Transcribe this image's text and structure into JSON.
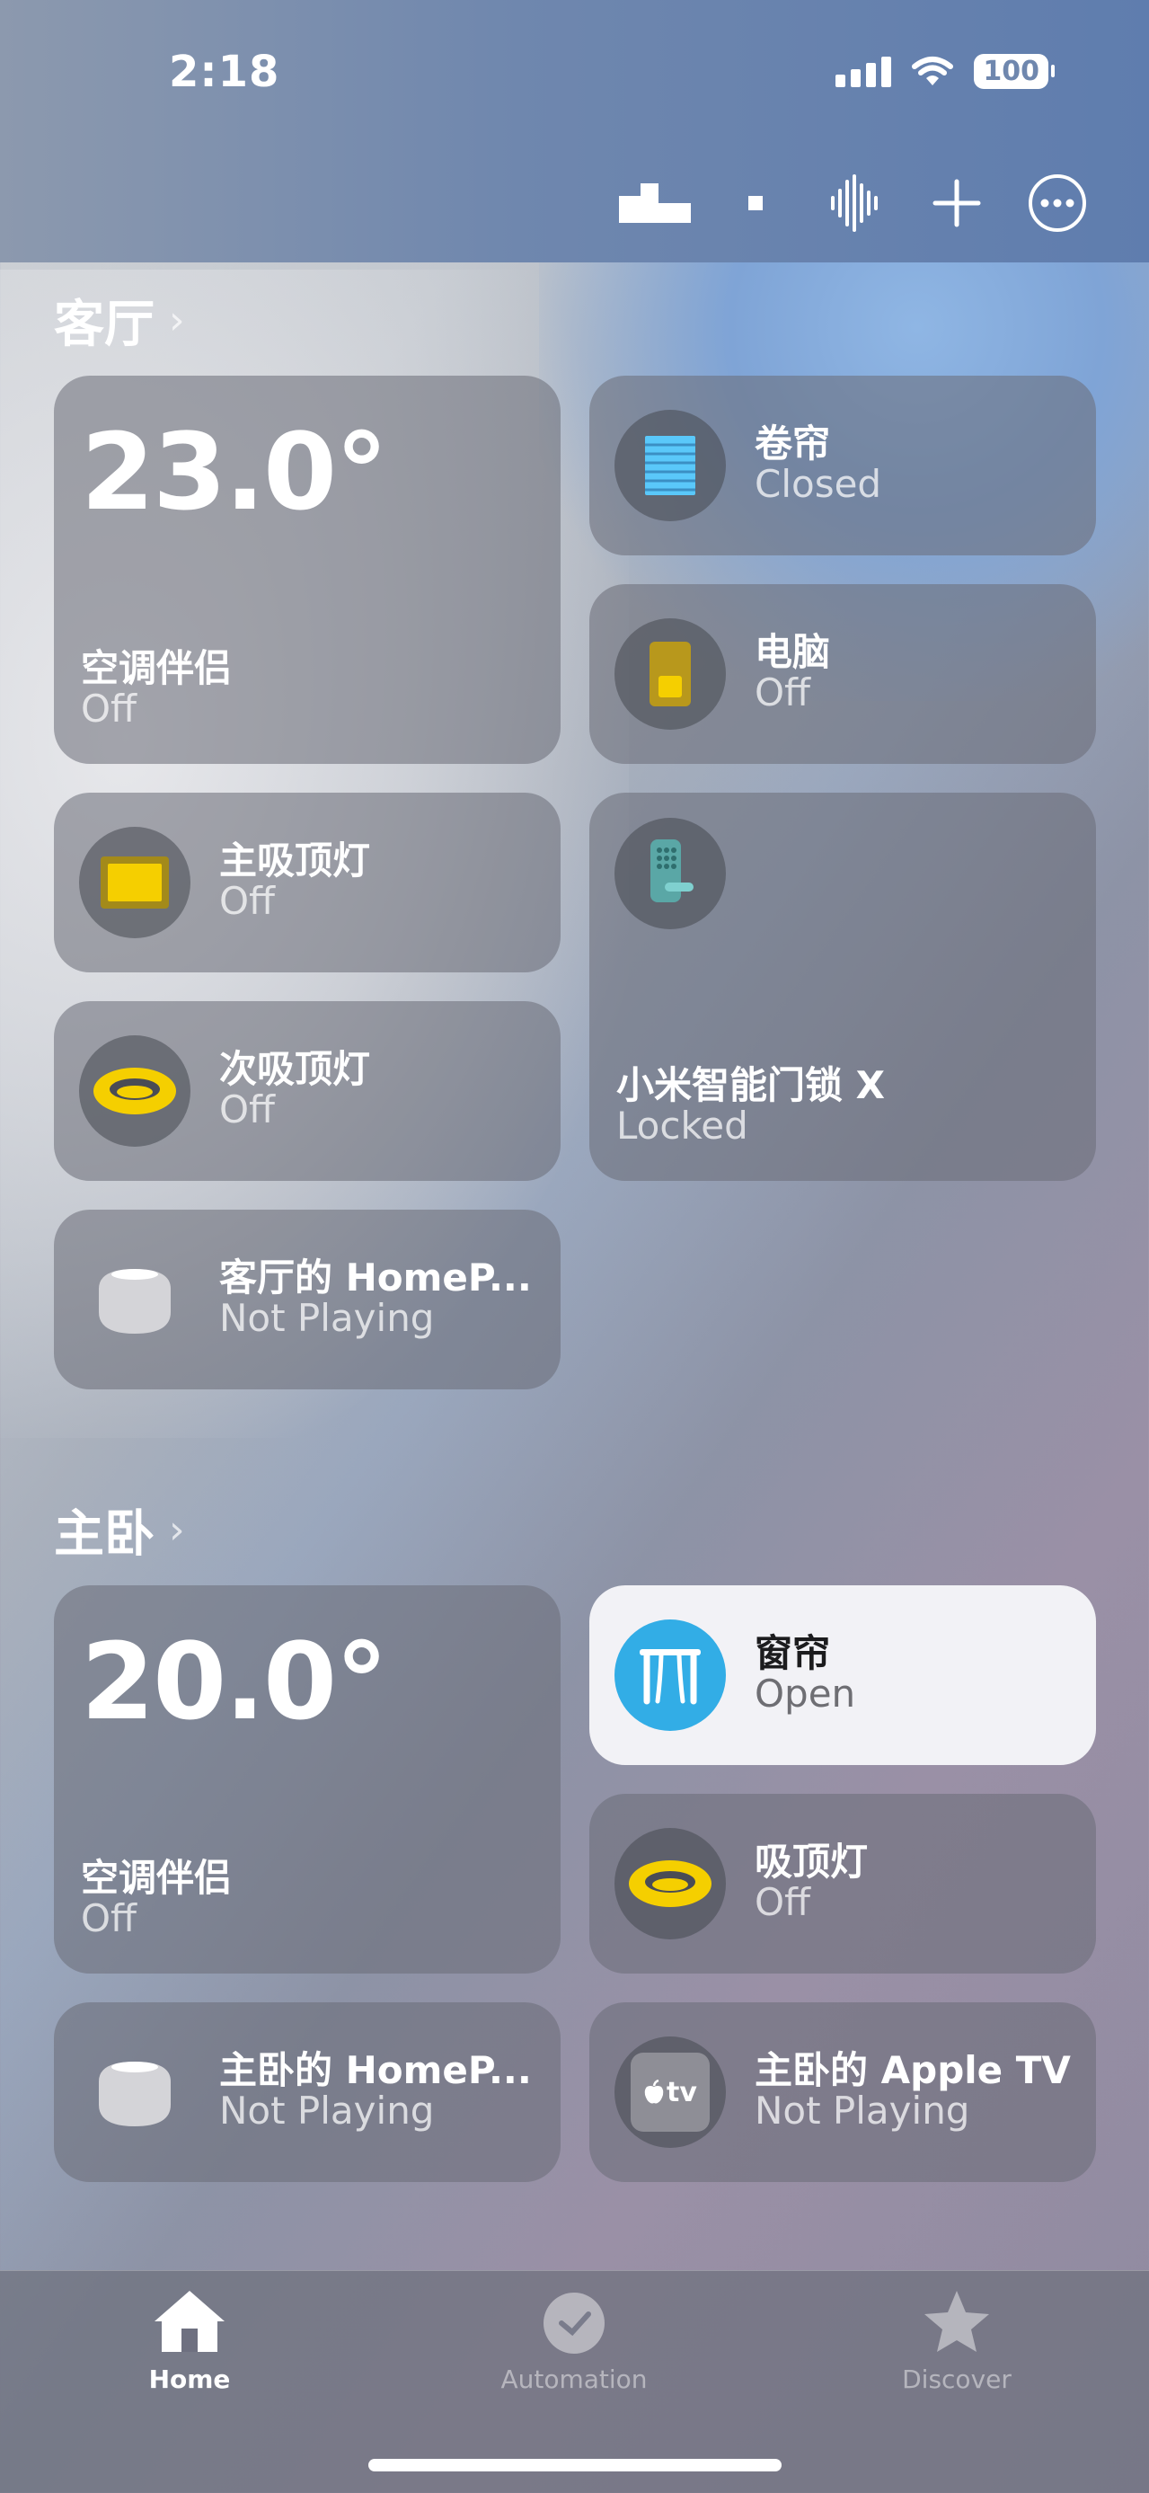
{
  "status_bar": {
    "time": "2:18",
    "battery": "100"
  },
  "rooms": [
    {
      "name": "客厅",
      "tiles": [
        {
          "name": "空调伴侣",
          "state": "Off",
          "temperature": "23.0°"
        },
        {
          "name": "卷帘",
          "state": "Closed",
          "icon": "blinds-icon"
        },
        {
          "name": "电脑",
          "state": "Off",
          "icon": "outlet-icon"
        },
        {
          "name": "主吸顶灯",
          "state": "Off",
          "icon": "panel-light-icon"
        },
        {
          "name": "小米智能门锁 X",
          "state": "Locked",
          "icon": "door-lock-icon"
        },
        {
          "name": "次吸顶灯",
          "state": "Off",
          "icon": "ceiling-light-icon"
        },
        {
          "name": "客厅的 HomeP...",
          "state": "Not Playing",
          "icon": "homepod-icon"
        }
      ]
    },
    {
      "name": "主卧",
      "tiles": [
        {
          "name": "空调伴侣",
          "state": "Off",
          "temperature": "20.0°"
        },
        {
          "name": "窗帘",
          "state": "Open",
          "icon": "curtain-icon"
        },
        {
          "name": "吸顶灯",
          "state": "Off",
          "icon": "ceiling-light-icon"
        },
        {
          "name": "主卧的 HomeP...",
          "state": "Not Playing",
          "icon": "homepod-icon"
        },
        {
          "name": "主卧的 Apple TV",
          "state": "Not Playing",
          "icon": "apple-tv-icon",
          "badge": "tv"
        }
      ]
    }
  ],
  "tabbar": {
    "tabs": [
      {
        "label": "Home",
        "icon": "house-icon",
        "selected": true
      },
      {
        "label": "Automation",
        "icon": "clock-check-icon",
        "selected": false
      },
      {
        "label": "Discover",
        "icon": "star-icon",
        "selected": false
      }
    ]
  },
  "colors": {
    "accent_active": "#32ade6",
    "light_yellow": "#f5cf00"
  }
}
